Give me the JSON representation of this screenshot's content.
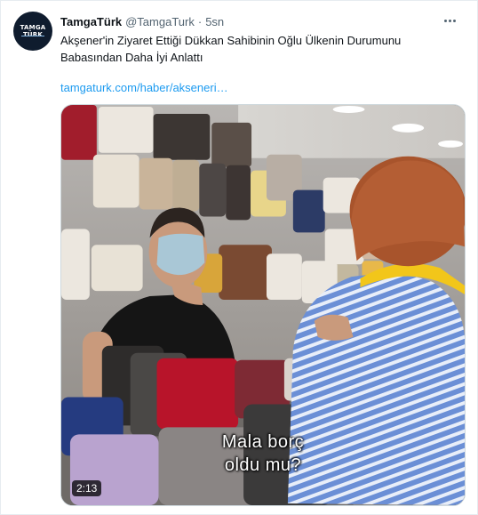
{
  "tweet": {
    "author_name": "TamgaTürk",
    "author_handle": "@TamgaTurk",
    "separator": "·",
    "time": "5sn",
    "avatar_text": "TAMGA TÜRK",
    "text": "Akşener'in Ziyaret Ettiği Dükkan Sahibinin Oğlu Ülkenin Durumunu Babasından Daha İyi Anlattı",
    "link": "tamgaturk.com/haber/akseneri…",
    "more_icon": "more-horizontal-icon"
  },
  "video": {
    "subtitle_line1": "Mala borç",
    "subtitle_line2": "oldu mu?",
    "duration": "2:13"
  },
  "colors": {
    "link": "#1d9bf0",
    "text": "#0f1419",
    "muted": "#536471"
  }
}
